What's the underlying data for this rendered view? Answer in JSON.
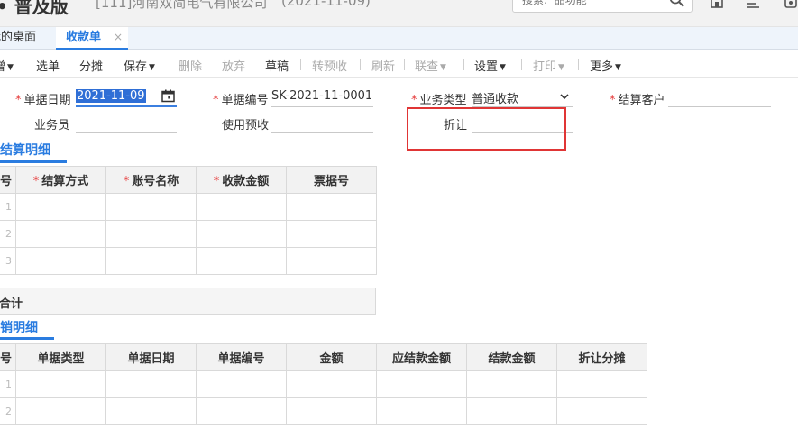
{
  "header": {
    "app_title": "• 普及版",
    "company": "[111]河南双简电气有限公司",
    "business_date": "(2021-11-09)",
    "search_placeholder": "搜索:  品功能",
    "icons": [
      "home-icon",
      "list-icon",
      "settings-icon"
    ]
  },
  "tabs": [
    {
      "label": "我的桌面"
    },
    {
      "label": "收款单",
      "active": true,
      "close": "×"
    }
  ],
  "toolbar": {
    "items": [
      {
        "label": "新增",
        "caret": "▼"
      },
      {
        "label": "选单"
      },
      {
        "label": "分摊"
      },
      {
        "label": "保存",
        "caret": "▼"
      },
      {
        "label": "删除",
        "disabled": true
      },
      {
        "label": "放弃",
        "disabled": true
      },
      {
        "label": "草稿"
      },
      {
        "label": "转预收",
        "disabled": true
      },
      {
        "label": "刷新",
        "disabled": true
      },
      {
        "label": "联查",
        "caret": "▼",
        "disabled": true
      },
      {
        "label": "设置",
        "caret": "▼"
      },
      {
        "label": "打印",
        "caret": "▼",
        "disabled": true
      },
      {
        "label": "更多",
        "caret": "▼"
      }
    ]
  },
  "form": {
    "doc_date_label": "单据日期",
    "doc_date_value": "2021-11-09",
    "doc_no_label": "单据编号",
    "doc_no_value": "SK-2021-11-0001",
    "biz_type_label": "业务类型",
    "biz_type_value": "普通收款",
    "customer_label": "结算客户",
    "customer_value": "",
    "salesman_label": "业务员",
    "salesman_value": "",
    "prepay_label": "使用预收",
    "prepay_value": "",
    "discount_label": "折让",
    "discount_value": "",
    "required_mark": "*"
  },
  "settlement": {
    "title": "多结算明细",
    "columns": [
      "行号",
      "结算方式",
      "账号名称",
      "收款金额",
      "票据号"
    ],
    "required": [
      false,
      true,
      true,
      true,
      false
    ],
    "rows": [
      [
        "1",
        "",
        "",
        "",
        ""
      ],
      [
        "2",
        "",
        "",
        "",
        ""
      ],
      [
        "3",
        "",
        "",
        "",
        ""
      ]
    ],
    "total_label": "合计"
  },
  "writeoff": {
    "title": "核销明细",
    "columns": [
      "行号",
      "单据类型",
      "单据日期",
      "单据编号",
      "金额",
      "应结款金额",
      "结款金额",
      "折让分摊"
    ],
    "rows": [
      [
        "1",
        "",
        "",
        "",
        "",
        "",
        "",
        ""
      ],
      [
        "2",
        "",
        "",
        "",
        "",
        "",
        "",
        ""
      ]
    ]
  },
  "colors": {
    "accent": "#2a7ce0",
    "required": "#e53b3b",
    "highlight": "#e03535",
    "date_selection": "#2f6fd6"
  }
}
